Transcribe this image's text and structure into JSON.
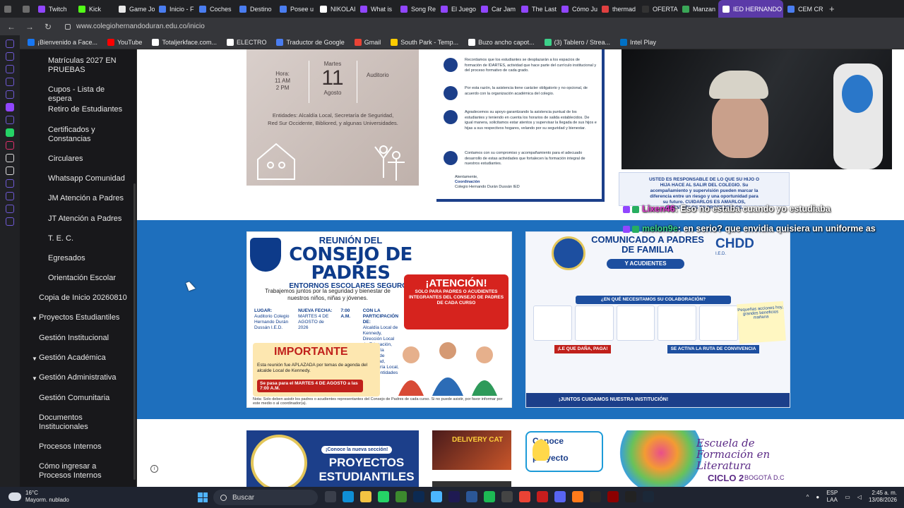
{
  "browser": {
    "tabs": [
      {
        "label": "Twitch",
        "color": "#9146ff"
      },
      {
        "label": "Kick",
        "color": "#53fc18"
      },
      {
        "label": "Game Jo",
        "color": "#e8e8e8"
      },
      {
        "label": "Inicio - F",
        "color": "#4a7df0"
      },
      {
        "label": "Coches",
        "color": "#4a7df0"
      },
      {
        "label": "Destino",
        "color": "#4a7df0"
      },
      {
        "label": "Posee u",
        "color": "#4a7df0"
      },
      {
        "label": "NIKOLAI",
        "color": "#ffffff"
      },
      {
        "label": "What is",
        "color": "#9146ff"
      },
      {
        "label": "Song Re",
        "color": "#9146ff"
      },
      {
        "label": "El Juego",
        "color": "#9146ff"
      },
      {
        "label": "Car Jam",
        "color": "#9146ff"
      },
      {
        "label": "The Last",
        "color": "#9146ff"
      },
      {
        "label": "Cómo Ju",
        "color": "#9146ff"
      },
      {
        "label": "thermad",
        "color": "#e04040"
      },
      {
        "label": "OFERTA",
        "color": "#333333"
      },
      {
        "label": "Manzan",
        "color": "#3aa757"
      },
      {
        "label": "IED HERNANDO",
        "color": "#ffffff"
      },
      {
        "label": "CEM CR",
        "color": "#4a7df0"
      }
    ],
    "active_tab": "IED HERNANDO",
    "new_tab": "+",
    "url": "www.colegiohernandoduran.edu.co/inicio",
    "bookmarks": [
      {
        "label": "¡Bienvenido a Face...",
        "color": "#1877f2"
      },
      {
        "label": "YouTube",
        "color": "#ff0000"
      },
      {
        "label": "Totaljerkface.com...",
        "color": "#ffffff"
      },
      {
        "label": "ELECTRO",
        "color": "#ffffff"
      },
      {
        "label": "Traductor de Google",
        "color": "#4a7df0"
      },
      {
        "label": "Gmail",
        "color": "#ea4335"
      },
      {
        "label": "South Park - Temp...",
        "color": "#ffcc00"
      },
      {
        "label": "Buzo ancho capot...",
        "color": "#ffffff"
      },
      {
        "label": "(3) Tablero / Strea...",
        "color": "#3cd18a"
      },
      {
        "label": "Intel Play",
        "color": "#0071c5"
      }
    ]
  },
  "sidebar": {
    "items": [
      {
        "label": "Matrículas 2027 EN PRUEBAS",
        "indent": 2,
        "chevron": false
      },
      {
        "label": "Cupos - Lista de espera",
        "indent": 2,
        "chevron": false
      },
      {
        "label": "Retiro de Estudiantes",
        "indent": 2,
        "chevron": false
      },
      {
        "label": "Certificados y Constancias",
        "indent": 2,
        "chevron": false
      },
      {
        "label": "Circulares",
        "indent": 2,
        "chevron": false
      },
      {
        "label": "Whatsapp Comunidad",
        "indent": 2,
        "chevron": false
      },
      {
        "label": "JM Atención a Padres",
        "indent": 2,
        "chevron": false
      },
      {
        "label": "JT Atención a Padres",
        "indent": 2,
        "chevron": false
      },
      {
        "label": "T. E. C.",
        "indent": 2,
        "chevron": false
      },
      {
        "label": "Egresados",
        "indent": 2,
        "chevron": false
      },
      {
        "label": "Orientación Escolar",
        "indent": 2,
        "chevron": false
      },
      {
        "label": "Copia de Inicio 20260810",
        "indent": 1,
        "chevron": false
      },
      {
        "label": "Proyectos Estudiantiles",
        "indent": 1,
        "chevron": true
      },
      {
        "label": "Gestión Institucional",
        "indent": 1,
        "chevron": false
      },
      {
        "label": "Gestión Académica",
        "indent": 1,
        "chevron": true
      },
      {
        "label": "Gestión Administrativa",
        "indent": 1,
        "chevron": true
      },
      {
        "label": "Gestión Comunitaria",
        "indent": 1,
        "chevron": false
      },
      {
        "label": "Documentos Institucionales",
        "indent": 1,
        "chevron": false
      },
      {
        "label": "Procesos Internos",
        "indent": 1,
        "chevron": false
      },
      {
        "label": "Cómo ingresar a Procesos Internos",
        "indent": 1,
        "chevron": false
      }
    ]
  },
  "event_card": {
    "hora_label": "Hora:",
    "hora_1": "11 AM",
    "hora_2": "2 PM",
    "weekday": "Martes",
    "day": "11",
    "month": "Agosto",
    "place": "Auditorio",
    "entities": "Entidades: Alcaldía Local, Secretaría de Seguridad, Red Sur Occidente, Bibliored, y algunas Universidades."
  },
  "letter": {
    "p1": "Recordamos que los estudiantes se desplazarán a los espacios de formación de IDARTES, actividad que hace parte del currículo institucional y del proceso formativo de cada grado.",
    "p2": "Por esta razón, la asistencia tiene carácter obligatorio y no opcional, de acuerdo con la organización académica del colegio.",
    "p3": "Agradecemos su apoyo garantizando la asistencia puntual de los estudiantes y teniendo en cuenta los horarios de salida establecidos. De igual manera, solicitamos estar atentos y supervisar la llegada de sus hijos e hijas a sus respectivos hogares, velando por su seguridad y bienestar.",
    "p4": "Contamos con su compromiso y acompañamiento para el adecuado desarrollo de estas actividades que fortalecen la formación integral de nuestros estudiantes.",
    "sign_1": "Atentamente,",
    "sign_2": "Coordinación",
    "sign_3": "Colegio Hernando Durán Dussán IED"
  },
  "consejo": {
    "t1": "REUNIÓN DEL",
    "t2": "CONSEJO DE PADRES",
    "t3": "ENTORNOS ESCOLARES SEGUROS",
    "sub": "Trabajemos juntos por la seguridad y bienestar de nuestros niños, niñas y jóvenes.",
    "atn_title": "¡ATENCIÓN!",
    "atn_text": "SOLO PARA PADRES O ACUDIENTES INTEGRANTES DEL CONSEJO DE PADRES DE CADA CURSO",
    "lugar_label": "LUGAR:",
    "lugar": "Auditorio Colegio Hernando Durán Dussán I.E.D.",
    "fecha_label": "NUEVA FECHA:",
    "fecha": "MARTES 4 DE AGOSTO de 2026",
    "hora": "7:00 A.M.",
    "part_label": "CON LA PARTICIPACIÓN DE:",
    "part": "Alcaldía Local de Kennedy, Dirección Local de Educación, Secretaría Distrital de Seguridad, Personería Local, y otras entidades",
    "imp_title": "IMPORTANTE",
    "imp_text": "Esta reunión fue APLAZADA por temas de agenda del alcalde Local de Kennedy.",
    "imp_band": "Se pasa para el MARTES 4 DE AGOSTO a las 7:00 A.M.",
    "note": "Nota: Solo deben asistir los padres o acudientes representantes del Consejo de Padres de cada curso. Si no puede asistir, por favor informar por este medio o al coordinador(a).",
    "badge": "CONSEJO DE PADRES"
  },
  "comunicado": {
    "title": "COMUNICADO A PADRES DE FAMILIA",
    "pill": "Y ACUDIENTES",
    "chdd": "CHDD",
    "chdd_sub": "I.E.D.",
    "question": "¿EN QUÉ NECESITAMOS SU COLABORACIÓN?",
    "note": "Pequeñas acciones hoy, grandes beneficios mañana",
    "pasa": "¡LE QUE DAÑA, PAGA!",
    "ruta": "SE ACTIVA LA RUTA DE CONVIVENCIA",
    "footer": "¡JUNTOS CUIDAMOS NUESTRA INSTITUCIÓN!"
  },
  "bottom": {
    "proy_tag": "¡Conoce la nueva sección!",
    "proy_title": "PROYECTOS ESTUDIANTILES",
    "game_title": "DELIVERY CAT",
    "conoce": "Conoce el proyecto",
    "esc_title": "Escuela de Formación en Literatura",
    "esc_ciclo": "CICLO 2",
    "esc_city": "BOGOTÁ D.C",
    "info": "i"
  },
  "stream": {
    "alert": "USTED ES RESPONSABLE DE LO QUE SU HIJO O HIJA HACE AL SALIR DEL COLEGIO. Su acompañamiento y supervisión pueden marcar la diferencia entre un riesgo y una oportunidad para su futuro. CUIDARLOS ES AMARLOS, ORIENTARLOS ES PROTEGERLOS.",
    "chat": [
      {
        "user": "Lixen46",
        "msg": ": Eso no estaba cuando yo estudiaba"
      },
      {
        "user": "melon9e",
        "msg": ": en serio? que envidia quisiera un uniforme as"
      }
    ]
  },
  "taskbar": {
    "temp": "16°C",
    "weather": "Mayorm. nublado",
    "search": "Buscar",
    "lang_1": "ESP",
    "lang_2": "LAA",
    "time": "2:45 a. m.",
    "date": "13/08/2026"
  }
}
